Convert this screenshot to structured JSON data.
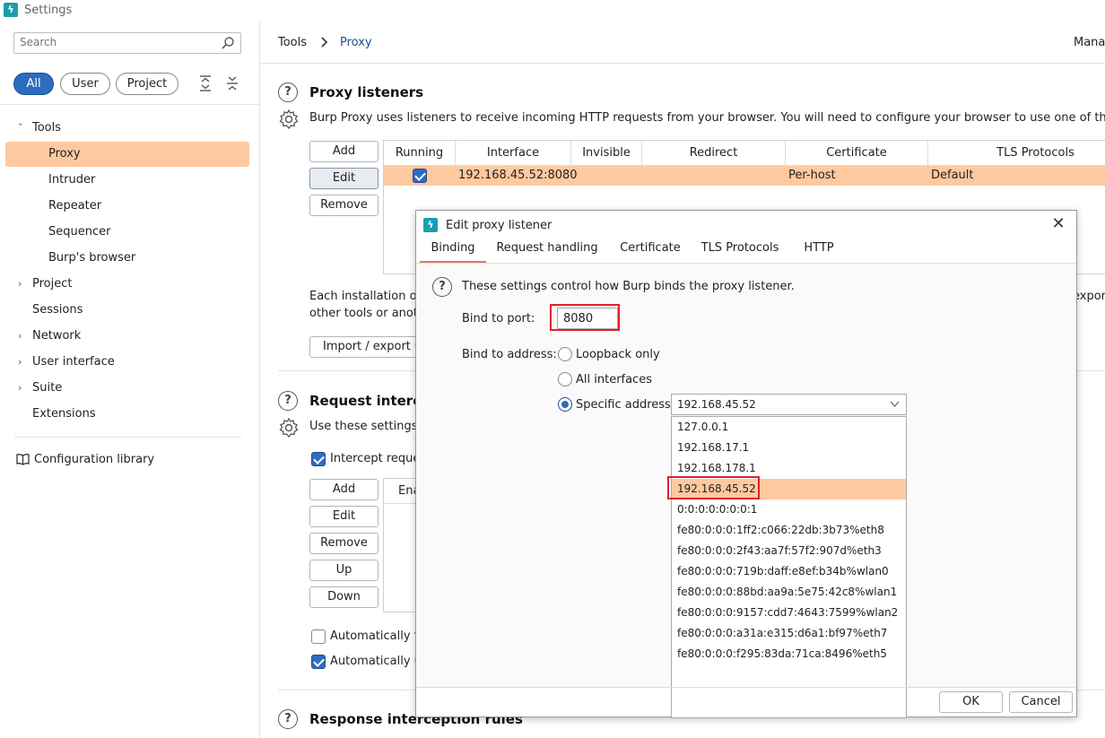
{
  "window": {
    "title": "Settings"
  },
  "sidebar": {
    "search_placeholder": "Search",
    "scopes": [
      "All",
      "User",
      "Project"
    ],
    "items": [
      {
        "label": "Tools",
        "chevron": "˅"
      },
      {
        "label": "Proxy"
      },
      {
        "label": "Intruder"
      },
      {
        "label": "Repeater"
      },
      {
        "label": "Sequencer"
      },
      {
        "label": "Burp's browser"
      },
      {
        "label": "Project",
        "chevron": "›"
      },
      {
        "label": "Sessions"
      },
      {
        "label": "Network",
        "chevron": "›"
      },
      {
        "label": "User interface",
        "chevron": "›"
      },
      {
        "label": "Suite",
        "chevron": "›"
      },
      {
        "label": "Extensions"
      }
    ],
    "config_library": "Configuration library"
  },
  "header": {
    "crumb1": "Tools",
    "crumb2": "Proxy",
    "right": "Mana"
  },
  "proxy_listeners": {
    "title": "Proxy listeners",
    "desc": "Burp Proxy uses listeners to receive incoming HTTP requests from your browser. You will need to configure your browser to use one of the listen",
    "buttons": {
      "add": "Add",
      "edit": "Edit",
      "remove": "Remove"
    },
    "columns": [
      "Running",
      "Interface",
      "Invisible",
      "Redirect",
      "Certificate",
      "TLS Protocols"
    ],
    "row": {
      "interface": "192.168.45.52:8080",
      "certificate": "Per-host",
      "tls": "Default"
    },
    "ca_text_1": "Each installation of",
    "ca_text_2": "other tools or anoth",
    "ca_text_right": "expor",
    "import_export": "Import / export C"
  },
  "request_interception": {
    "title": "Request intercep",
    "desc": "Use these settings t",
    "intercept_label": "Intercept reques",
    "buttons": {
      "add": "Add",
      "edit": "Edit",
      "remove": "Remove",
      "up": "Up",
      "down": "Down"
    },
    "col_enabled": "Ena",
    "auto_fix": "Automatically fix",
    "auto_update": "Automatically up"
  },
  "response_interception": {
    "title": "Response interception rules"
  },
  "dialog": {
    "title": "Edit proxy listener",
    "tabs": [
      "Binding",
      "Request handling",
      "Certificate",
      "TLS Protocols",
      "HTTP"
    ],
    "info": "These settings control how Burp binds the proxy listener.",
    "port_label": "Bind to port:",
    "port_value": "8080",
    "address_label": "Bind to address:",
    "loopback": "Loopback only",
    "all_interfaces": "All interfaces",
    "specific": "Specific address:",
    "selected_address": "192.168.45.52",
    "addresses": [
      "127.0.0.1",
      "192.168.17.1",
      "192.168.178.1",
      "192.168.45.52",
      "0:0:0:0:0:0:0:1",
      "fe80:0:0:0:1ff2:c066:22db:3b73%eth8",
      "fe80:0:0:0:2f43:aa7f:57f2:907d%eth3",
      "fe80:0:0:0:719b:daff:e8ef:b34b%wlan0",
      "fe80:0:0:0:88bd:aa9a:5e75:42c8%wlan1",
      "fe80:0:0:0:9157:cdd7:4643:7599%wlan2",
      "fe80:0:0:0:a31a:e315:d6a1:bf97%eth7",
      "fe80:0:0:0:f295:83da:71ca:8496%eth5"
    ],
    "ok": "OK",
    "cancel": "Cancel"
  },
  "colors": {
    "accent": "#2d6cc0",
    "selection": "#ffc9a0",
    "highlight": "#e0202a",
    "brand": "#1a9dad"
  }
}
